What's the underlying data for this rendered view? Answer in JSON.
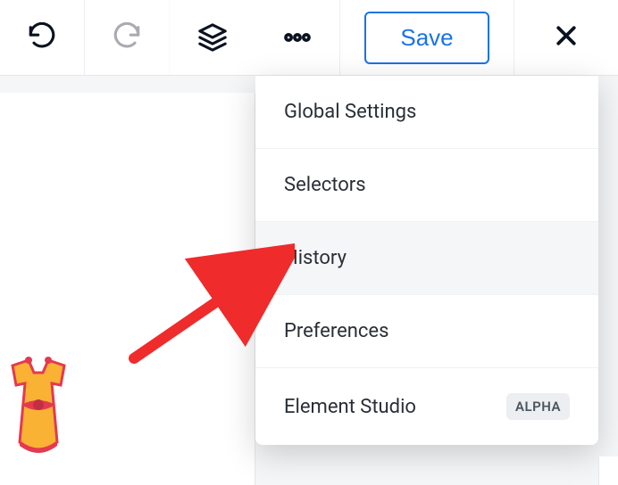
{
  "toolbar": {
    "save_label": "Save"
  },
  "dropdown": {
    "items": [
      {
        "label": "Global Settings",
        "badge": ""
      },
      {
        "label": "Selectors",
        "badge": ""
      },
      {
        "label": "History",
        "badge": ""
      },
      {
        "label": "Preferences",
        "badge": ""
      },
      {
        "label": "Element Studio",
        "badge": "ALPHA"
      }
    ]
  }
}
